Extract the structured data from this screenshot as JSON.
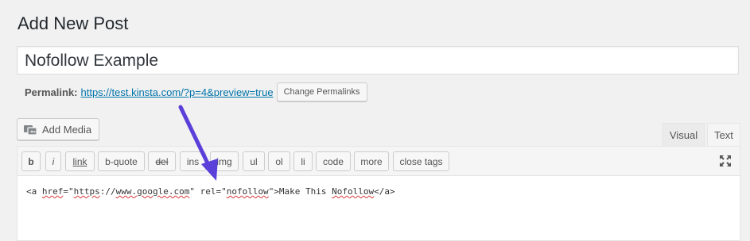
{
  "page": {
    "title": "Add New Post"
  },
  "post": {
    "title_value": "Nofollow Example"
  },
  "permalink": {
    "label": "Permalink:",
    "url": "https://test.kinsta.com/?p=4&preview=true",
    "change_button": "Change Permalinks"
  },
  "media": {
    "add_media_label": "Add Media",
    "icon": "media-icon"
  },
  "editor_tabs": {
    "visual": "Visual",
    "text": "Text",
    "active": "Text"
  },
  "quicktags": [
    {
      "label": "b"
    },
    {
      "label": "i"
    },
    {
      "label": "link"
    },
    {
      "label": "b-quote"
    },
    {
      "label": "del"
    },
    {
      "label": "ins"
    },
    {
      "label": "img"
    },
    {
      "label": "ul"
    },
    {
      "label": "ol"
    },
    {
      "label": "li"
    },
    {
      "label": "code"
    },
    {
      "label": "more"
    },
    {
      "label": "close tags"
    }
  ],
  "editor": {
    "code": {
      "p1": "<a ",
      "p2": "href",
      "p3": "=\"",
      "p4": "https",
      "p5": "://",
      "p6": "www.google.com",
      "p7": "\" rel=\"",
      "p8": "nofollow",
      "p9": "\">Make This ",
      "p10": "Nofollow",
      "p11": "</a>"
    }
  },
  "colors": {
    "link": "#0073aa",
    "arrow": "#5b3fd9",
    "spellcheck": "#d63638"
  },
  "icons": {
    "fullscreen": "fullscreen-icon",
    "arrow": "annotation-arrow"
  }
}
